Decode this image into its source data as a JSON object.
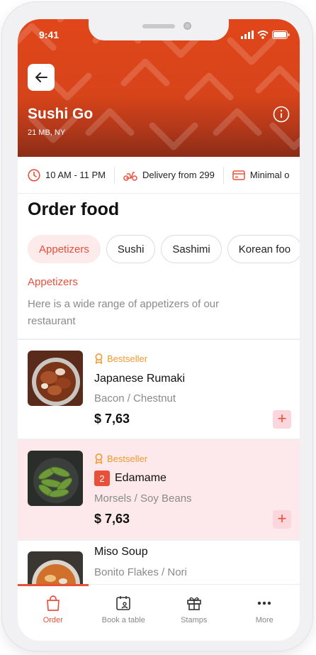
{
  "status_bar": {
    "time": "9:41"
  },
  "restaurant": {
    "name": "Sushi Go",
    "subtitle": "21 MB, NY"
  },
  "info_bar": [
    {
      "icon": "clock-icon",
      "text": "10 AM - 11 PM"
    },
    {
      "icon": "scooter-icon",
      "text": "Delivery from 299"
    },
    {
      "icon": "card-icon",
      "text": "Minimal o"
    }
  ],
  "page_title": "Order food",
  "tabs": [
    {
      "label": "Appetizers",
      "active": true
    },
    {
      "label": "Sushi"
    },
    {
      "label": "Sashimi"
    },
    {
      "label": "Korean foo"
    }
  ],
  "section": {
    "title": "Appetizers",
    "description": "Here is a wide range of appetizers of our restaurant"
  },
  "items": [
    {
      "badge": "Bestseller",
      "name": "Japanese Rumaki",
      "description": "Bacon / Chestnut",
      "price": "$ 7,63",
      "add": "+"
    },
    {
      "badge": "Bestseller",
      "quantity": "2",
      "name": "Edamame",
      "description": "Morsels / Soy Beans",
      "price": "$ 7,63",
      "add": "+"
    },
    {
      "name": "Miso Soup",
      "description": "Bonito Flakes / Nori"
    }
  ],
  "bottom_nav": [
    {
      "label": "Order",
      "icon": "bag-icon",
      "active": true
    },
    {
      "label": "Book a table",
      "icon": "calendar-icon"
    },
    {
      "label": "Stamps",
      "icon": "gift-icon"
    },
    {
      "label": "More",
      "icon": "more-dots-icon"
    }
  ],
  "colors": {
    "accent": "#e8503a",
    "header": "#d8441a",
    "highlight": "#fde8ec",
    "badge": "#f29a2e"
  }
}
